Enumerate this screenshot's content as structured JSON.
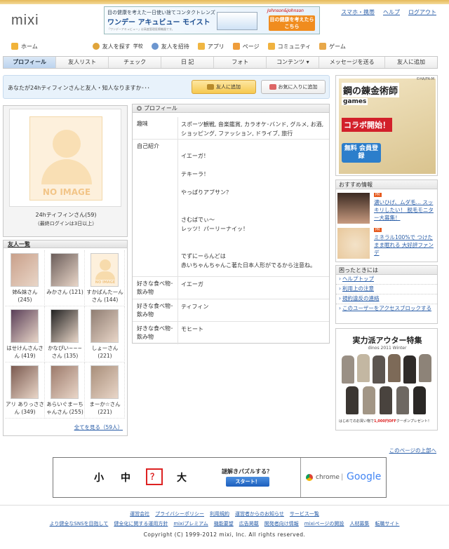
{
  "brand": {
    "logo": "mixi"
  },
  "header_ad": {
    "line1": "目の健康を考えた一日使い捨てコンタクトレンズ",
    "product": "ワンデー アキュビュー モイスト",
    "fine": "「ワンデーアキュビュー」は高度管理医療機器です。",
    "brand": "Johnson&Johnson",
    "cta": "目の健康を考えたらこちら"
  },
  "top_links": [
    "スマホ・携帯",
    "ヘルプ",
    "ログアウト"
  ],
  "nav_primary": [
    {
      "label": "ホーム",
      "icon": "home-icon"
    },
    {
      "label": "友人を探す",
      "sub": "学校",
      "icon": "search-icon"
    },
    {
      "label": "友人を招待",
      "icon": "invite-icon"
    },
    {
      "label": "アプリ",
      "icon": "app-icon"
    },
    {
      "label": "ページ",
      "icon": "page-icon"
    },
    {
      "label": "コミュニティ",
      "icon": "community-icon"
    },
    {
      "label": "ゲーム",
      "icon": "game-icon"
    }
  ],
  "nav_tabs": [
    "プロフィール",
    "友人リスト",
    "チェック",
    "日 記",
    "フォト",
    "コンテンツ ▾",
    "メッセージを送る",
    "友人に追加"
  ],
  "add_bar": {
    "message": "あなたが24hティフィンさんと友人・知人なりますか･･･",
    "add_button": "友人に追加",
    "fav_button": "お気に入りに追加"
  },
  "profile_photo": {
    "noimage": "NO IMAGE",
    "name": "24hティフィンさん(59)",
    "last_login": "（最終ログインは3日以上）"
  },
  "friends": {
    "title": "友人一覧",
    "items": [
      {
        "name": "姉&妹さん (245)",
        "color": "#c9a08a"
      },
      {
        "name": "みかさん (121)",
        "color": "#6b5d5a"
      },
      {
        "name": "すかばんたーんさん (144)",
        "color": "noimage"
      },
      {
        "name": "はせけんさんさん (419)",
        "color": "#5a3f58"
      },
      {
        "name": "かなぴい~~~さん (135)",
        "color": "#222222"
      },
      {
        "name": "しょーさん (221)",
        "color": "#8f7d72"
      },
      {
        "name": "アリ ありっささん (349)",
        "color": "#7b5a50"
      },
      {
        "name": "あらいぐまーちゃんさん (255)",
        "color": "#9c7a6b"
      },
      {
        "name": "まーか☆さん (221)",
        "color": "#a88e7a"
      }
    ],
    "noimage_small": "NO IMAGE",
    "see_all": "全てを見る（59人）"
  },
  "profile": {
    "title": "プロフィール",
    "rows": [
      {
        "key": "趣味",
        "value": "スポーツ観戦, 音楽鑑賞, カラオケ･バンド, グルメ, お酒, ショッピング, ファッション, ドライブ, 旅行"
      },
      {
        "key": "自己紹介",
        "lines": [
          "",
          "イエーガ！",
          "",
          "テキーラ！",
          "",
          "やっぱりアブサン？",
          "",
          "",
          "さむばでぃ～",
          "レッツ！パーリーナイッ！",
          "",
          "",
          "でずにーらんどは",
          "赤いちゃんちゃんこ著た日本人形がでるから注意ね。"
        ]
      },
      {
        "key": "好きな食べ物･飲み物",
        "value": "イエーガ"
      },
      {
        "key": "好きな食べ物･飲み物",
        "value": "ティフィン"
      },
      {
        "key": "好きな食べ物･飲み物",
        "value": "モヒート"
      }
    ]
  },
  "right_ad": {
    "line1": "鋼の錬金術師",
    "line2": "games",
    "line3": "コラボ開始！",
    "line4": "無料 会員登録",
    "credit": "©HA/FA-M"
  },
  "recommend": {
    "title": "おすすめ情報",
    "items": [
      {
        "pr": "PR",
        "text": "濃いひげ、ムダ毛… スッキリしたい！ 脱毛モニター大募集！"
      },
      {
        "pr": "PR",
        "text": "ミネラル100%で つけたまま眠れる 大好評ファンデ"
      }
    ]
  },
  "help": {
    "title": "困ったときには",
    "items": [
      "ヘルプトップ",
      "利用上の注意",
      "規約違反の連絡",
      "このユーザーをアクセスブロックする"
    ]
  },
  "coat_ad": {
    "title": "実力派アウター特集",
    "sub": "dinos 2011 Winter",
    "foot_pre": "はじめてのお買い物で",
    "foot_em": "1,000円OFF",
    "foot_post": "クーポンプレゼント！"
  },
  "page_top": "このページの上部へ",
  "bottom_ad": {
    "c1": "小",
    "c2": "中",
    "q": "？",
    "c3": "大",
    "puzzle": "謎解きパズルする？",
    "start": "スタート！",
    "chrome": "chrome",
    "google": "Google"
  },
  "footer": {
    "row1": [
      "運営会社",
      "プライバシーポリシー",
      "利用規約",
      "運営者からのお知らせ",
      "サービス一覧"
    ],
    "row2": [
      "より健全なSNSを目指して",
      "健全化に関する運用方針",
      "mixiプレミアム",
      "機能要望",
      "広告掲載",
      "開発者向け情報",
      "mixiページの開設",
      "人材募集",
      "転職サイト"
    ],
    "copyright": "Copyright (C) 1999-2012 mixi, Inc. All rights reserved."
  }
}
